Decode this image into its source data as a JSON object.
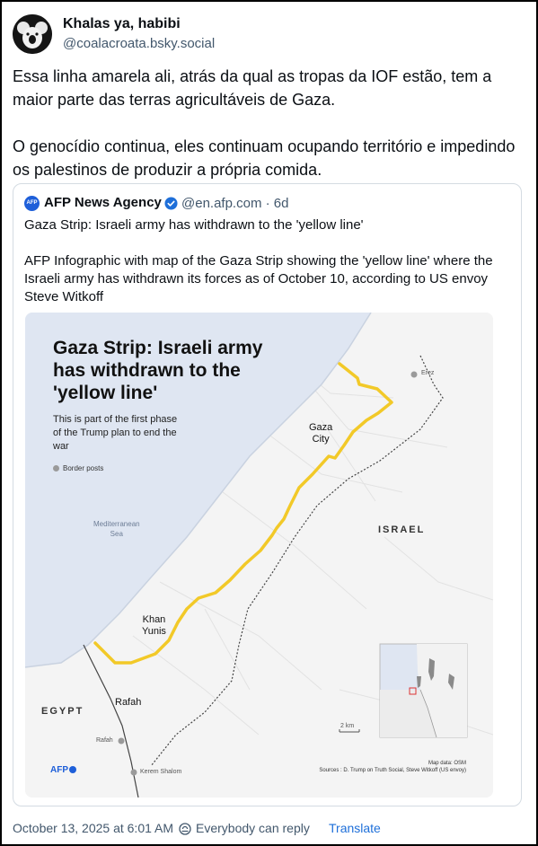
{
  "post": {
    "author_name": "Khalas ya, habibi",
    "author_handle": "@coalacroata.bsky.social",
    "paragraphs": [
      "Essa linha amarela ali, atrás da qual as tropas da IOF estão, tem a maior parte das terras agricultáveis de Gaza.",
      "O genocídio continua, eles continuam ocupando território e impedindo os palestinos de produzir a própria comida."
    ]
  },
  "quote": {
    "avatar_text": "AFP",
    "author_name": "AFP News Agency",
    "author_handle": "@en.afp.com",
    "separator": "·",
    "age": "6d",
    "paragraphs": [
      "Gaza Strip: Israeli army has withdrawn to the 'yellow line'",
      "AFP Infographic with map of the Gaza Strip showing the 'yellow line' where the Israeli army has withdrawn its forces as of October 10, according to US envoy Steve Witkoff"
    ]
  },
  "infographic": {
    "title": "Gaza Strip: Israeli army has withdrawn to the 'yellow line'",
    "subtitle": "This is part of the first phase of the Trump plan to end the war",
    "legend": "Border posts",
    "sea_label": "Mediterranean\nSea",
    "country_israel": "ISRAEL",
    "country_egypt": "EGYPT",
    "city_gaza": "Gaza\nCity",
    "city_khan_yunis": "Khan\nYunis",
    "city_rafah": "Rafah",
    "post_erez": "Erez",
    "post_rafah": "Rafah",
    "post_kerem_shalom": "Kerem Shalom",
    "scale": "2 km",
    "map_data": "Map data: OSM",
    "sources": "Sources : D. Trump on Truth Social, Steve Witkoff (US envoy)",
    "logo": "AFP",
    "colors": {
      "yellow_line": "#f2c928",
      "sea": "#dfe6f2",
      "land": "#f4f4f4"
    }
  },
  "footer": {
    "timestamp": "October 13, 2025 at 6:01 AM",
    "reply_setting": "Everybody can reply",
    "translate": "Translate"
  }
}
